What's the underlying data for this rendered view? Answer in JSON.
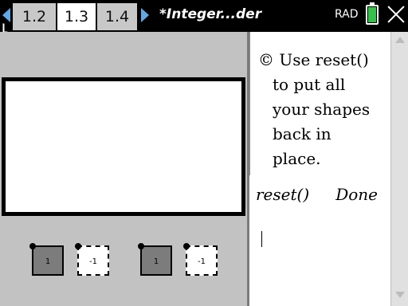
{
  "topbar": {
    "tabs": [
      "1.2",
      "1.3",
      "1.4"
    ],
    "active_tab": "1.3",
    "doc_title": "*Integer...der",
    "angle_mode": "RAD",
    "battery_level": 0.9,
    "battery_color": "#35c24a"
  },
  "notes": {
    "symbol": "©",
    "line1": "Use reset()",
    "line2": "to put all",
    "line3": "your shapes",
    "line4": "back in",
    "line5": "place."
  },
  "calculator": {
    "history": [
      {
        "expr": "reset()",
        "result": "Done"
      }
    ],
    "input": ""
  },
  "tiles": [
    {
      "label": "1",
      "kind": "positive"
    },
    {
      "label": "-1",
      "kind": "negative"
    },
    {
      "label": "1",
      "kind": "positive"
    },
    {
      "label": "-1",
      "kind": "negative"
    }
  ],
  "colors": {
    "tab_bar": "#000000",
    "tab_inactive": "#c8c8c8",
    "tab_active": "#ffffff",
    "nav_arrow": "#5fa9e6",
    "graphics_bg": "#c2c2c2",
    "positive_tile": "#7c7c7c"
  }
}
